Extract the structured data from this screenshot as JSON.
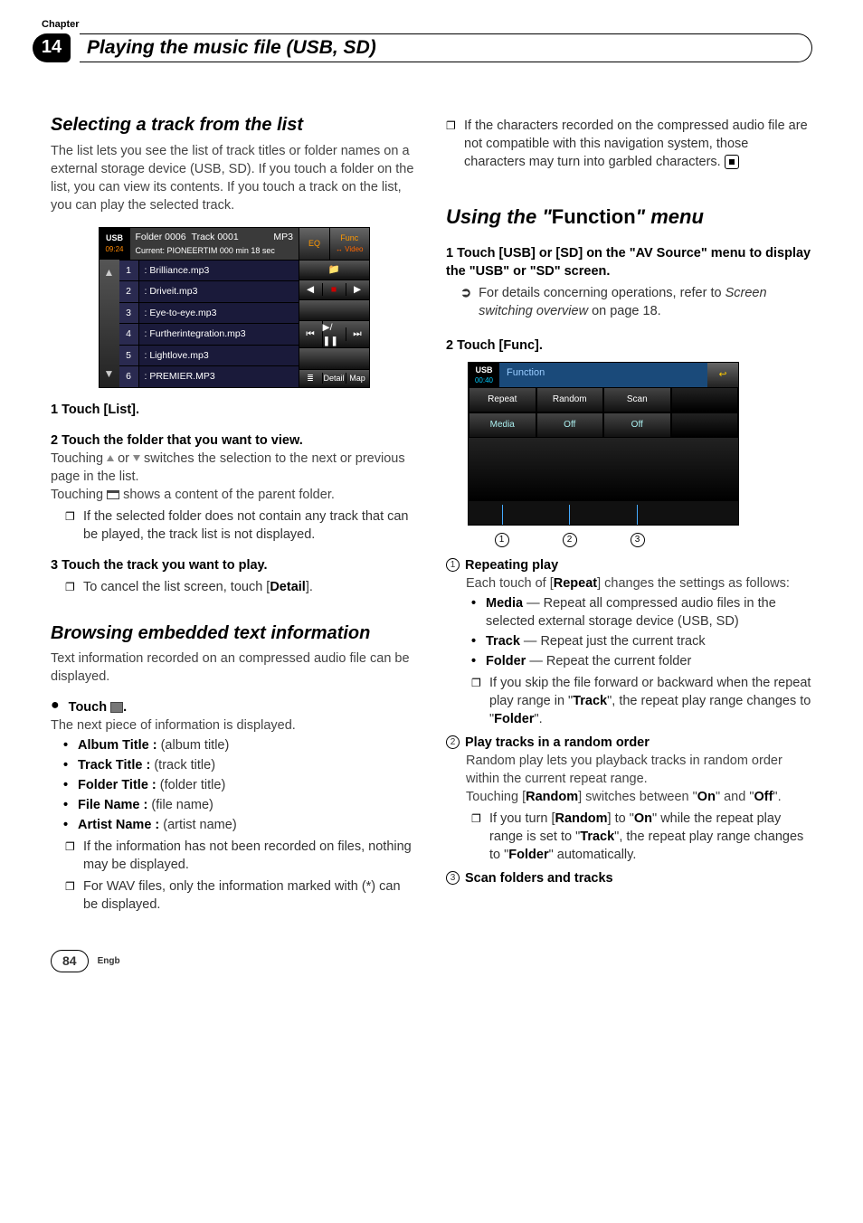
{
  "header": {
    "chapter_label": "Chapter",
    "chapter_number": "14",
    "chapter_title": "Playing the music file (USB, SD)"
  },
  "left": {
    "h_select": "Selecting a track from the list",
    "select_intro": "The list lets you see the list of track titles or folder names on a external storage device (USB, SD). If you touch a folder on the list, you can view its contents. If you touch a track on the list, you can play the selected track.",
    "shot1": {
      "badge_label": "USB",
      "badge_time": "09:24",
      "folder": "Folder 0006",
      "track": "Track 0001",
      "codec": "MP3",
      "current": "Current: PIONEERTIM  000 min 18 sec",
      "eq": "EQ",
      "func": "Func",
      "video": "↔ Video",
      "rows": [
        {
          "n": "1",
          "t": ": Brilliance.mp3"
        },
        {
          "n": "2",
          "t": ": Driveit.mp3"
        },
        {
          "n": "3",
          "t": ": Eye-to-eye.mp3"
        },
        {
          "n": "4",
          "t": ": Furtherintegration.mp3"
        },
        {
          "n": "5",
          "t": ": Lightlove.mp3"
        },
        {
          "n": "6",
          "t": ": PREMIER.MP3"
        }
      ],
      "prev": "⏮",
      "play": "▶/❚❚",
      "next": "⏭",
      "left_tri": "◀",
      "stop": "■",
      "right_tri": "▶",
      "folder_icon": "📁",
      "detail": "Detail",
      "map": "Map",
      "list_icon": "≣"
    },
    "step1": "1   Touch [List].",
    "step2": "2   Touch the folder that you want to view.",
    "step2_a": "Touching ",
    "step2_b": " or ",
    "step2_c": " switches the selection to the next or previous page in the list.",
    "step2_d": "Touching ",
    "step2_e": " shows a content of the parent folder.",
    "step2_note": "If the selected folder does not contain any track that can be played, the track list is not displayed.",
    "step3": "3   Touch the track you want to play.",
    "step3_note_a": "To cancel the list screen, touch [",
    "step3_note_b": "Detail",
    "step3_note_c": "].",
    "h_browse": "Browsing embedded text information",
    "browse_intro": "Text information recorded on an compressed audio file can be displayed.",
    "touch_lead": "Touch ",
    "touch_tail": ".",
    "next_info": "The next piece of information is displayed.",
    "info_items": [
      {
        "b": "Album Title :",
        "t": " (album title)"
      },
      {
        "b": "Track Title :",
        "t": " (track title)"
      },
      {
        "b": "Folder Title :",
        "t": " (folder title)"
      },
      {
        "b": "File Name :",
        "t": " (file name)"
      },
      {
        "b": "Artist Name :",
        "t": " (artist name)"
      }
    ],
    "info_note1": "If the information has not been recorded on files, nothing may be displayed.",
    "info_note2": "For WAV files, only the information marked with (*) can be displayed."
  },
  "right": {
    "top_note_a": "If the characters recorded on the compressed audio file are not compatible with this navigation system, those characters may turn into garbled characters.",
    "h_func_a": "Using the ",
    "h_func_b": "\"",
    "h_func_c": "Function",
    "h_func_d": "\"",
    "h_func_e": " menu",
    "func_step1": "1   Touch [USB] or [SD] on the \"AV Source\" menu to display the \"USB\" or \"SD\" screen.",
    "func_refer_a": "For details concerning operations, refer to ",
    "func_refer_b": "Screen switching overview",
    "func_refer_c": " on page 18.",
    "func_step2": "2   Touch [Func].",
    "shot2": {
      "badge_label": "USB",
      "badge_time": "00:40",
      "title": "Function",
      "back": "↩",
      "cols": [
        {
          "h": "Repeat",
          "v": "Media"
        },
        {
          "h": "Random",
          "v": "Off"
        },
        {
          "h": "Scan",
          "v": "Off"
        }
      ]
    },
    "call1": "1",
    "call2": "2",
    "call3": "3",
    "rep_h": "Repeating play",
    "rep_p_a": "Each touch of [",
    "rep_p_b": "Repeat",
    "rep_p_c": "] changes the settings as follows:",
    "rep_items": [
      {
        "b": "Media",
        "t": " — Repeat all compressed audio files in the selected external storage device (USB, SD)"
      },
      {
        "b": "Track",
        "t": " — Repeat just the current track"
      },
      {
        "b": "Folder",
        "t": " — Repeat the current folder"
      }
    ],
    "rep_note_a": "If you skip the file forward or backward when the repeat play range in \"",
    "rep_note_b": "Track",
    "rep_note_c": "\", the repeat play range changes to \"",
    "rep_note_d": "Folder",
    "rep_note_e": "\".",
    "rand_h": "Play tracks in a random order",
    "rand_p": "Random play lets you playback tracks in random order within the current repeat range.",
    "rand_p2_a": "Touching [",
    "rand_p2_b": "Random",
    "rand_p2_c": "] switches between \"",
    "rand_p2_d": "On",
    "rand_p2_e": "\" and \"",
    "rand_p2_f": "Off",
    "rand_p2_g": "\".",
    "rand_note_a": "If you turn [",
    "rand_note_b": "Random",
    "rand_note_c": "] to \"",
    "rand_note_d": "On",
    "rand_note_e": "\" while the repeat play range is set to \"",
    "rand_note_f": "Track",
    "rand_note_g": "\", the repeat play range changes to \"",
    "rand_note_h": "Folder",
    "rand_note_i": "\" automatically.",
    "scan_h": "Scan folders and tracks"
  },
  "footer": {
    "page": "84",
    "lang": "Engb"
  }
}
